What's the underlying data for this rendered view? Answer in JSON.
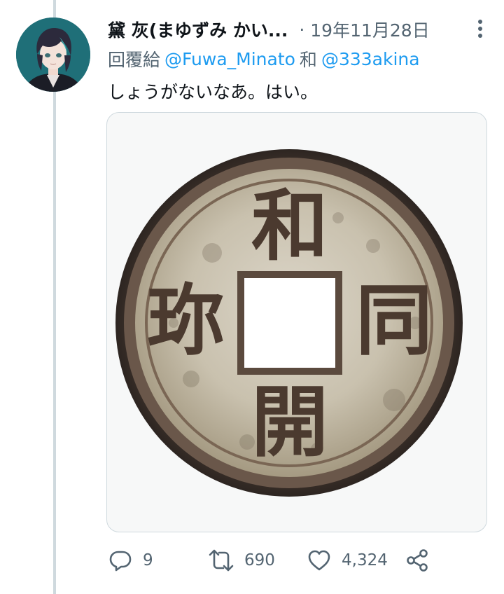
{
  "tweet": {
    "author_name": "黛 灰(まゆずみ かい...",
    "timestamp": "19年11月28日",
    "reply_prefix": "回覆給",
    "reply_mentions": [
      "@Fuwa_Minato",
      "@333akina"
    ],
    "reply_separator": "和",
    "text": "しょうがないなあ。はい。",
    "image": {
      "coin_characters": [
        "和",
        "同",
        "開",
        "珎"
      ]
    },
    "stats": {
      "replies": "9",
      "retweets": "690",
      "likes": "4,324"
    }
  },
  "icons": {
    "more": "more-vertical-icon",
    "reply": "reply-icon",
    "retweet": "retweet-icon",
    "like": "heart-icon",
    "share": "share-icon"
  },
  "colors": {
    "accent": "#1d9bf0",
    "muted": "#536471",
    "text": "#0f1419",
    "thread_line": "#cfd9de"
  }
}
